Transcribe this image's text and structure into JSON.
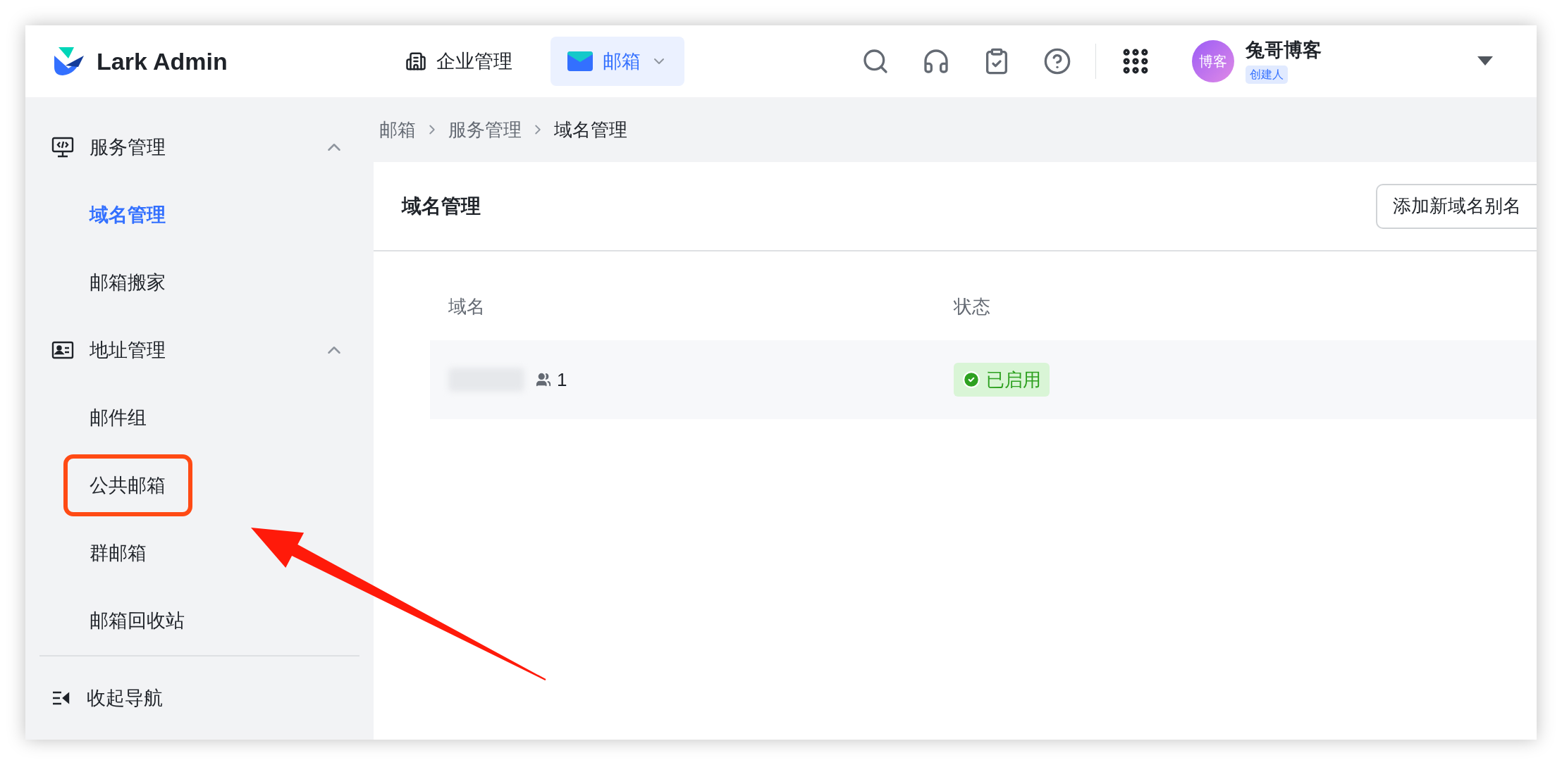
{
  "header": {
    "logo": "Lark Admin",
    "nav": [
      {
        "label": "企业管理",
        "selected": false
      },
      {
        "label": "邮箱",
        "selected": true
      }
    ],
    "user": {
      "avatar_text": "博客",
      "name": "兔哥博客",
      "role": "创建人"
    }
  },
  "sidebar": {
    "groups": [
      {
        "label": "服务管理",
        "expanded": true,
        "items": [
          {
            "label": "域名管理",
            "selected": true,
            "annotated": false
          },
          {
            "label": "邮箱搬家",
            "selected": false,
            "annotated": false
          }
        ]
      },
      {
        "label": "地址管理",
        "expanded": true,
        "items": [
          {
            "label": "邮件组",
            "selected": false,
            "annotated": false
          },
          {
            "label": "公共邮箱",
            "selected": false,
            "annotated": true
          },
          {
            "label": "群邮箱",
            "selected": false,
            "annotated": false
          },
          {
            "label": "邮箱回收站",
            "selected": false,
            "annotated": false
          }
        ]
      }
    ],
    "collapse": "收起导航"
  },
  "breadcrumb": [
    "邮箱",
    "服务管理",
    "域名管理"
  ],
  "card": {
    "title": "域名管理",
    "button": "添加新域名别名",
    "table": {
      "columns": [
        "域名",
        "状态"
      ],
      "rows": [
        {
          "members": "1",
          "status": "已启用",
          "enabled": true
        }
      ]
    }
  }
}
